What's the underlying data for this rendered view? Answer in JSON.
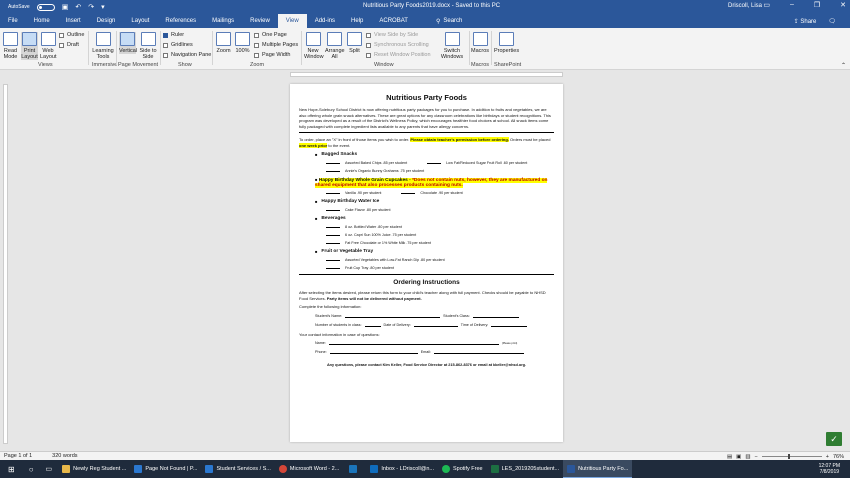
{
  "titlebar": {
    "autosave": "AutoSave",
    "autosave_state": "Off",
    "title": "Nutritious Party Foods2019.docx  -  Saved to this PC",
    "user": "Driscoll, Lisa"
  },
  "menu": {
    "tabs": [
      "File",
      "Home",
      "Insert",
      "Design",
      "Layout",
      "References",
      "Mailings",
      "Review",
      "View",
      "Add-ins",
      "Help",
      "ACROBAT"
    ],
    "search": "Search",
    "share": "Share",
    "comments": "Comments"
  },
  "ribbon": {
    "views": {
      "read": "Read Mode",
      "print": "Print Layout",
      "web": "Web Layout",
      "group": "Views"
    },
    "immersive": {
      "learning": "Learning Tools",
      "group": "Immersive"
    },
    "pagemove": {
      "vertical": "Vertical",
      "side": "Side to Side",
      "group": "Page Movement"
    },
    "show": {
      "ruler": "Ruler",
      "grid": "Gridlines",
      "nav": "Navigation Pane",
      "outline": "Outline",
      "draft": "Draft",
      "group": "Show"
    },
    "zoom": {
      "zoom": "Zoom",
      "pct": "100%",
      "one": "One Page",
      "multi": "Multiple Pages",
      "width": "Page Width",
      "group": "Zoom"
    },
    "window": {
      "newwin": "New Window",
      "arrange": "Arrange All",
      "split": "Split",
      "sbs": "View Side by Side",
      "sync": "Synchronous Scrolling",
      "reset": "Reset Window Position",
      "switch": "Switch Windows",
      "group": "Window"
    },
    "macros": {
      "label": "Macros",
      "group": "Macros"
    },
    "sp": {
      "label": "Properties",
      "group": "SharePoint"
    }
  },
  "doc": {
    "title": "Nutritious Party Foods",
    "intro": "New Hope-Solebury School District is now offering nutritious party packages for you to purchase.  In addition to fruits and vegetables, we are also offering whole grain snack alternatives.  These are great options for any classroom celebrations like birthdays or student recognitions.  This program was developed as a result of the District's Wellness Policy, which encourages healthier food choices at school.  All snack items come fully packaged with complete ingredient lists available to any parents that have allergy concerns.",
    "order_a": "To order, place an \"X\" in front of those items you wish to order.  ",
    "order_hl1": "Please obtain teacher's permission before ordering.",
    "order_b": "  Orders must be placed ",
    "order_hl2": "one week prior",
    "order_c": " to the event.",
    "sections": [
      {
        "name": "Bagged Snacks",
        "rows": [
          [
            "Assorted Baked Chips   .85 per student",
            "Low Fat/Reduced Sugar Fruit Roll   .60 per student"
          ],
          [
            "Annie's Organic Bunny Grahams   .75 per student"
          ]
        ]
      },
      {
        "name": "Happy Birthday Whole Grain Cupcakes - ",
        "note": "*Does not contain nuts, however, they are manufactured on shared equipment that also processes products containing nuts.",
        "rows": [
          [
            "Vanilla   .90 per student",
            "Chocolate   .90 per student"
          ]
        ]
      },
      {
        "name": "Happy Birthday Water Ice",
        "rows": [
          [
            "Cake Flavor   .80 per student"
          ]
        ]
      },
      {
        "name": "Beverages",
        "rows": [
          [
            "8 oz. Bottled Water   .80 per student"
          ],
          [
            "6 oz. Capri Sun 100% Juice   .75 per student"
          ],
          [
            "Fat Free Chocolate or 1% White Milk   .75 per student"
          ]
        ]
      },
      {
        "name": "Fruit or Vegetable Tray",
        "rows": [
          [
            "Assorted Vegetables with Low-Fat Ranch Dip   .80 per student"
          ],
          [
            "Fruit Cup Tray   .80 per student"
          ]
        ]
      }
    ],
    "ordering_title": "Ordering Instructions",
    "ordering_a": "After selecting the items desired, please return this form to your child's teacher along with full payment.  Checks should be payable to NHSD Food Services.  ",
    "ordering_b": "Party items will not be delivered without payment.",
    "complete": "Complete the following information:",
    "student_name": "Student's Name:",
    "student_class": "Student's Class:",
    "num_students": "Number of students in class:",
    "date_delivery": "Date of Delivery:",
    "time_delivery": "Time of Delivery:",
    "contact": "Your contact information in case of questions:",
    "name": "Name:",
    "print": "(Please print)",
    "phone": "Phone:",
    "email": "Email:",
    "footer": "Any questions, please contact Kim Keller, Food Service Director at 215-862-8376 or email at kkeller@nhsd.org."
  },
  "status": {
    "page": "Page 1 of 1",
    "words": "320 words",
    "zoom": "76%"
  },
  "taskbar": {
    "items": [
      "Newly Reg Student ...",
      "Page Not Found | P...",
      "Student Services / S...",
      "Microsoft Word - 2...",
      "",
      "Inbox - LDriscoll@n...",
      "Spotify Free",
      "LES_2019205student...",
      "Nutritious Party Fo..."
    ],
    "time": "12:07 PM",
    "date": "7/8/2019"
  }
}
